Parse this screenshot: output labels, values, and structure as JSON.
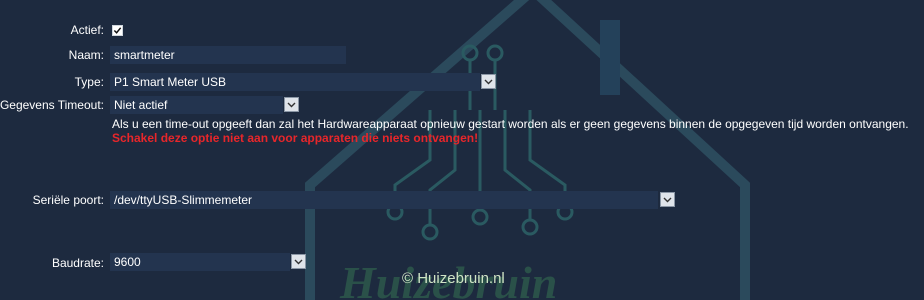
{
  "form": {
    "active_label": "Actief:",
    "active_checked": true,
    "name_label": "Naam:",
    "name_value": "smartmeter",
    "type_label": "Type:",
    "type_value": "P1 Smart Meter USB",
    "timeout_label": "Gegevens Timeout:",
    "timeout_value": "Niet actief",
    "timeout_hint": "Als u een time-out opgeeft dan zal het Hardwareapparaat opnieuw gestart worden als er geen gegevens binnen de opgegeven tijd worden ontvangen.",
    "timeout_warning": "Schakel deze optie niet aan voor apparaten die niets ontvangen!",
    "serial_label": "Seriële poort:",
    "serial_value": "/dev/ttyUSB-Slimmemeter",
    "baud_label": "Baudrate:",
    "baud_value": "9600"
  },
  "watermark": {
    "text": "© Huizebruin.nl"
  },
  "colors": {
    "background": "#1d2a3f",
    "field": "#23344f",
    "warning": "#e8262a"
  },
  "icons": {
    "dropdown": "chevron-down-icon",
    "checkbox": "checkmark-icon"
  }
}
